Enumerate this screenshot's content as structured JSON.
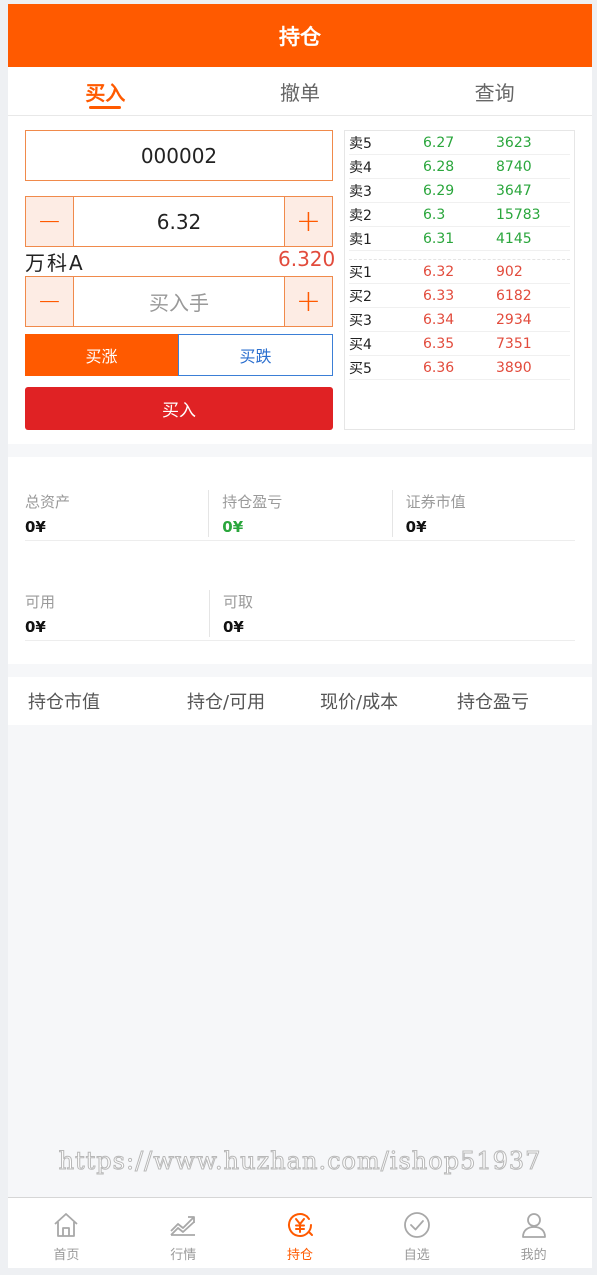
{
  "header": {
    "title": "持仓"
  },
  "tabs": [
    {
      "label": "买入",
      "active": true
    },
    {
      "label": "撤单",
      "active": false
    },
    {
      "label": "查询",
      "active": false
    }
  ],
  "trade": {
    "code": "000002",
    "price_minus": "−",
    "price_value": "6.32",
    "price_plus": "+",
    "stock_name": "万科A",
    "stock_price": "6.320",
    "qty_minus": "−",
    "qty_placeholder": "买入手",
    "qty_plus": "+",
    "buy_up_label": "买涨",
    "buy_down_label": "买跌",
    "buy_button": "买入"
  },
  "order_book": {
    "sell": [
      {
        "label": "卖5",
        "price": "6.27",
        "volume": "3623"
      },
      {
        "label": "卖4",
        "price": "6.28",
        "volume": "8740"
      },
      {
        "label": "卖3",
        "price": "6.29",
        "volume": "3647"
      },
      {
        "label": "卖2",
        "price": "6.3",
        "volume": "15783"
      },
      {
        "label": "卖1",
        "price": "6.31",
        "volume": "4145"
      }
    ],
    "buy": [
      {
        "label": "买1",
        "price": "6.32",
        "volume": "902"
      },
      {
        "label": "买2",
        "price": "6.33",
        "volume": "6182"
      },
      {
        "label": "买3",
        "price": "6.34",
        "volume": "2934"
      },
      {
        "label": "买4",
        "price": "6.35",
        "volume": "7351"
      },
      {
        "label": "买5",
        "price": "6.36",
        "volume": "3890"
      }
    ],
    "sell_color": "#2aa63c",
    "buy_color": "#e24b3c"
  },
  "assets": {
    "total_label": "总资产",
    "total_value": "0¥",
    "pnl_label": "持仓盈亏",
    "pnl_value": "0¥",
    "market_label": "证券市值",
    "market_value": "0¥",
    "available_label": "可用",
    "available_value": "0¥",
    "withdrawable_label": "可取",
    "withdrawable_value": "0¥"
  },
  "holdings_header": {
    "col1": "持仓市值",
    "col2": "持仓/可用",
    "col3": "现价/成本",
    "col4": "持仓盈亏"
  },
  "watermark": "https://www.huzhan.com/ishop51937",
  "tabbar": [
    {
      "label": "首页",
      "icon": "home-icon",
      "active": false
    },
    {
      "label": "行情",
      "icon": "trend-chart-icon",
      "active": false
    },
    {
      "label": "持仓",
      "icon": "yuan-position-icon",
      "active": true
    },
    {
      "label": "自选",
      "icon": "check-circle-icon",
      "active": false
    },
    {
      "label": "我的",
      "icon": "user-icon",
      "active": false
    }
  ],
  "colors": {
    "brand": "#ff5a00",
    "buy_button": "#e02224",
    "down_button_border": "#3b7fd6"
  }
}
